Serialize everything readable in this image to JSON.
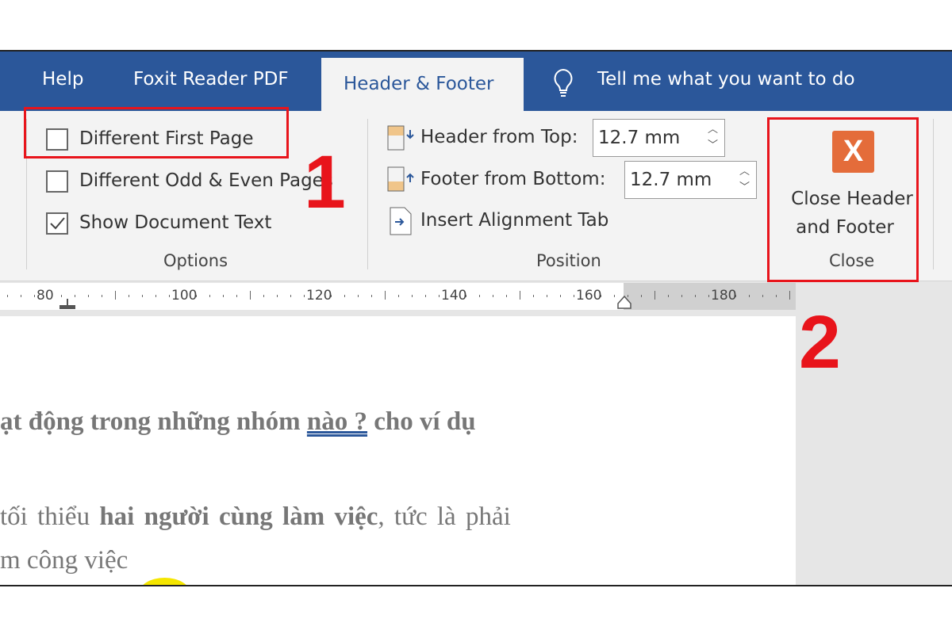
{
  "tabs": {
    "help": "Help",
    "foxit": "Foxit Reader PDF",
    "active": "Header & Footer",
    "tell_me": "Tell me what you want to do"
  },
  "options": {
    "different_first_page": {
      "label": "Different First Page",
      "checked": false
    },
    "different_odd_even": {
      "label": "Different Odd & Even Pages",
      "checked": false
    },
    "show_document_text": {
      "label": "Show Document Text",
      "checked": true
    },
    "group_label": "Options"
  },
  "position": {
    "header_from_top_label": "Header from Top:",
    "header_from_top_value": "12.7 mm",
    "footer_from_bottom_label": "Footer from Bottom:",
    "footer_from_bottom_value": "12.7 mm",
    "insert_alignment_tab": "Insert Alignment Tab",
    "group_label": "Position"
  },
  "close": {
    "button_line1": "Close Header",
    "button_line2": "and Footer",
    "group_label": "Close",
    "icon_color": "#e46c3a"
  },
  "annotations": {
    "step1": "1",
    "step2": "2",
    "color": "#e8141b"
  },
  "ruler": {
    "labels": [
      "80",
      "100",
      "120",
      "140",
      "160",
      "180"
    ]
  },
  "document": {
    "line1_a": "ạt động trong những nhóm ",
    "line1_b": "nào ?",
    "line1_c": " cho ví dụ",
    "line2_a": " tối thiểu ",
    "line2_b": "hai người cùng làm việc",
    "line2_c": ", tức là phải",
    "line3": "m công việc"
  },
  "colors": {
    "tab_bar": "#2b579a",
    "ribbon": "#f3f3f3"
  }
}
